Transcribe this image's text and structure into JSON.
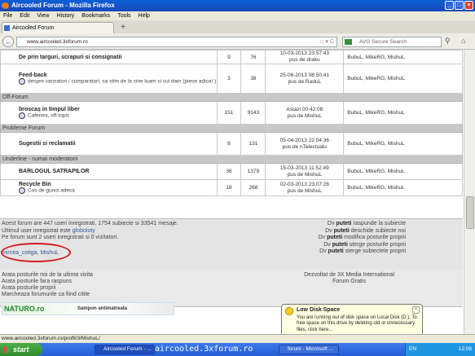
{
  "window": {
    "title": "Aircooled Forum - Mozilla Firefox",
    "controls": [
      "_",
      "□",
      "×"
    ]
  },
  "menu": [
    "File",
    "Edit",
    "View",
    "History",
    "Bookmarks",
    "Tools",
    "Help"
  ],
  "tab": {
    "label": "Aircooled Forum",
    "new_tab": "+"
  },
  "nav": {
    "back": "←",
    "url": "www.aircooled.3xforum.ro",
    "url_controls": "☆ ▾ C",
    "search_placeholder": "AVG Secure Search",
    "home": "⌂"
  },
  "forums": [
    {
      "type": "forum",
      "title": "De prin targuri, scrapuri si consignatii",
      "desc": "",
      "topics": "9",
      "posts": "76",
      "last_date": "10-03-2013 23:57:43",
      "last_by": "pus de draku",
      "mods": "BubuL, MikeRG, MishuL"
    },
    {
      "type": "forum",
      "title": "Feed-back",
      "desc": "despre vanzatori / cumparatori, sa stim de la cine luam si cui dam (piese adica! )",
      "topics": "3",
      "posts": "38",
      "last_date": "25-06-2013 08:50:41",
      "last_by": "pus de RaduL",
      "mods": "BubuL, MikeRG, MishuL"
    },
    {
      "type": "category",
      "title": "Off-Forum"
    },
    {
      "type": "forum",
      "title": "broscaș in timpul liber",
      "desc": "Cafenea, off-topic",
      "topics": "151",
      "posts": "9143",
      "last_date": "Astazi 00:42:08",
      "last_by": "pus de MishuL",
      "mods": "BubuL, MikeRG, MishuL"
    },
    {
      "type": "category",
      "title": "Probleme Forum"
    },
    {
      "type": "forum",
      "title": "Sugestii si reclamatii",
      "desc": "",
      "topics": "8",
      "posts": "131",
      "last_date": "05-04-2013 22:04:36",
      "last_by": "pus de nTelectualu",
      "mods": "BubuL, MikeRG, MishuL"
    },
    {
      "type": "category",
      "title": "Underline - numai moderatorii"
    },
    {
      "type": "forum",
      "title": "BARLOGUL SATRAPILOR",
      "desc": "",
      "topics": "36",
      "posts": "1379",
      "last_date": "15-03-2013 11:52:49",
      "last_by": "pus de MishuL",
      "mods": "BubuL, MikeRG, MishuL"
    },
    {
      "type": "forum",
      "title": "Recycle Bin",
      "desc": "Cos de gunoi adeca",
      "topics": "18",
      "posts": "268",
      "last_date": "02-03-2013 23:07:26",
      "last_by": "pus de MishuL",
      "mods": "BubuL, MikeRG, MishuL"
    }
  ],
  "stats": {
    "line1": "Acest forum are 447 useri inregistrati, 1754 subiecte si 33541 mesaje.",
    "line2_prefix": "Ultimul user inregistrat este ",
    "line2_user": "globoloty",
    "line3": "Pe forum sunt 2 useri inregistrati si 0 vizitatori.",
    "online_users": "mircea_cotiga, MishuL",
    "perms": [
      {
        "pre": "Dv ",
        "bold": "puteti",
        "post": " raspunde la subiecte"
      },
      {
        "pre": "Dv ",
        "bold": "puteti",
        "post": " deschide subiecte noi"
      },
      {
        "pre": "Dv ",
        "bold": "puteti",
        "post": " modifica posturile proprii"
      },
      {
        "pre": "Dv ",
        "bold": "puteti",
        "post": " sterge posturile proprii"
      },
      {
        "pre": "Dv ",
        "bold": "puteti",
        "post": " sterge subiectele proprii"
      }
    ]
  },
  "footer": {
    "links": [
      "Arata posturile noi de la ultima vizita",
      "Arata posturile fara raspuns",
      "Arata posturile proprii",
      "Marcheaza forumurile ca fiind citite"
    ],
    "credit1": "Dezvoltat de 3X Media International",
    "credit2": "Forum Gratis"
  },
  "banner": {
    "logo": "NATURO.ro",
    "slogan": "Sampon antimatreata"
  },
  "balloon": {
    "title": "Low Disk Space",
    "text": "You are running out of disk space on Local Disk (D:). To free space on this drive by deleting old or unnecessary files, click here...",
    "close": "×"
  },
  "status": {
    "url": "www.aircooled.3xforum.ro/profil/3/MishuL/"
  },
  "taskbar": {
    "start": "start",
    "tasks": [
      "Aircooled Forum - ...",
      "forum - Microsoft ..."
    ],
    "lang": "EN",
    "clock": "12:08"
  },
  "caption": "aircooled.3xforum.ro"
}
